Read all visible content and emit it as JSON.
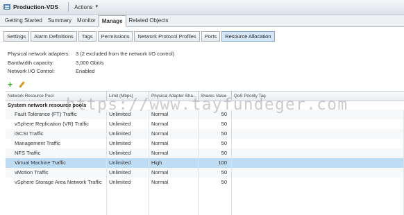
{
  "window": {
    "title": "Production-VDS",
    "actions_label": "Actions"
  },
  "main_tabs": [
    {
      "label": "Getting Started"
    },
    {
      "label": "Summary"
    },
    {
      "label": "Monitor"
    },
    {
      "label": "Manage"
    },
    {
      "label": "Related Objects"
    }
  ],
  "sub_tabs": [
    {
      "label": "Settings"
    },
    {
      "label": "Alarm Definitions"
    },
    {
      "label": "Tags"
    },
    {
      "label": "Permissions"
    },
    {
      "label": "Network Protocol Profiles"
    },
    {
      "label": "Ports"
    },
    {
      "label": "Resource Allocation"
    }
  ],
  "info": {
    "adapters_label": "Physical network adapters:",
    "adapters_value": "3 (2 excluded from the network I/O control)",
    "bandwidth_label": "Bandwidth capacity:",
    "bandwidth_value": "3,000 Gbit/s",
    "nioc_label": "Network I/O Control:",
    "nioc_value": "Enabled"
  },
  "table": {
    "headers": [
      "Network Resource Pool",
      "Limit (Mbps)",
      "Physical Adapter Sha...",
      "Shares Value",
      "QoS Priority Tag"
    ],
    "group_label": "System network resource pools",
    "rows": [
      {
        "name": "Fault Tolerance (FT) Traffic",
        "limit": "Unlimited",
        "shares": "Normal",
        "value": "50",
        "qos": ""
      },
      {
        "name": "vSphere Replication (VR) Traffic",
        "limit": "Unlimited",
        "shares": "Normal",
        "value": "50",
        "qos": ""
      },
      {
        "name": "iSCSI Traffic",
        "limit": "Unlimited",
        "shares": "Normal",
        "value": "50",
        "qos": ""
      },
      {
        "name": "Management Traffic",
        "limit": "Unlimited",
        "shares": "Normal",
        "value": "50",
        "qos": ""
      },
      {
        "name": "NFS Traffic",
        "limit": "Unlimited",
        "shares": "Normal",
        "value": "50",
        "qos": ""
      },
      {
        "name": "Virtual Machine Traffic",
        "limit": "Unlimited",
        "shares": "High",
        "value": "100",
        "qos": ""
      },
      {
        "name": "vMotion Traffic",
        "limit": "Unlimited",
        "shares": "Normal",
        "value": "50",
        "qos": ""
      },
      {
        "name": "vSphere Storage Area Network Traffic",
        "limit": "Unlimited",
        "shares": "Normal",
        "value": "50",
        "qos": ""
      }
    ]
  },
  "watermark": "https://www.tayfundeger.com",
  "colors": {
    "selected_row": "#bfdcf5",
    "active_subtab": "#d4e6f7",
    "add_icon": "#3a9a2a"
  }
}
